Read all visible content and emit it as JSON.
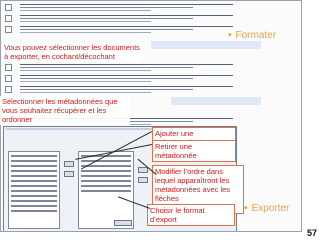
{
  "callouts": {
    "select_docs": "Vous pouvez sélectionner les documents à exporter, en cochant/décochant",
    "select_meta": "Sélectionner les métadonnées que vous souhaitez récupérer et les ordonner",
    "add_meta": "Ajouter une métadonnée",
    "remove_meta": "Retirer une métadonnée",
    "reorder": "Modifier l’ordre dans lequel apparaîtront les métadonnées avec les flèches monter/descendre",
    "choose_format": "Choisir le format d’export"
  },
  "side_labels": {
    "formater": "Formater",
    "exporter": "Exporter"
  },
  "page_number": "57",
  "colors": {
    "callout_text": "#cc1a1a",
    "side_label": "#e8a04a",
    "bullet": "#ff9900"
  }
}
